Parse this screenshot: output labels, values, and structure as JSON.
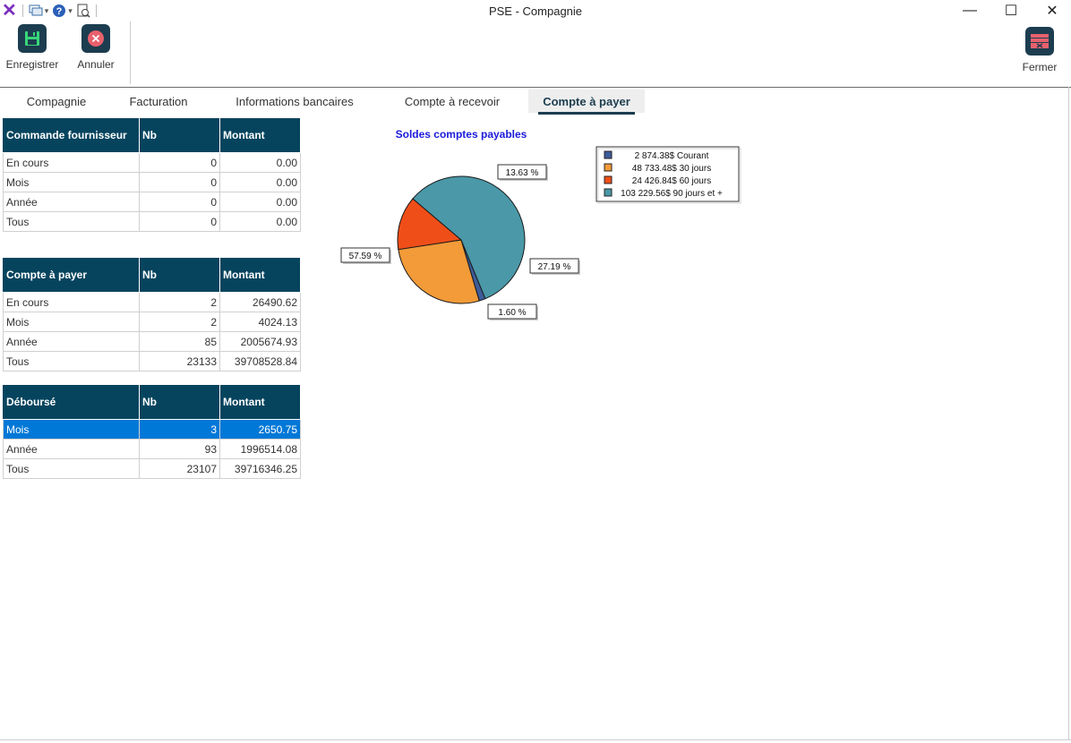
{
  "window": {
    "title": "PSE - Compagnie",
    "minimize": "—",
    "maximize": "☐",
    "close": "✕"
  },
  "toolbar": {
    "save_label": "Enregistrer",
    "cancel_label": "Annuler",
    "close_label": "Fermer"
  },
  "tabs": [
    {
      "label": "Compagnie"
    },
    {
      "label": "Facturation"
    },
    {
      "label": "Informations bancaires"
    },
    {
      "label": "Compte à recevoir"
    },
    {
      "label": "Compte à payer",
      "active": true
    }
  ],
  "tables": {
    "commande": {
      "headers": [
        "Commande fournisseur",
        "Nb",
        "Montant"
      ],
      "rows": [
        [
          "En cours",
          "0",
          "0.00"
        ],
        [
          "Mois",
          "0",
          "0.00"
        ],
        [
          "Année",
          "0",
          "0.00"
        ],
        [
          "Tous",
          "0",
          "0.00"
        ]
      ]
    },
    "compte": {
      "headers": [
        "Compte à payer",
        "Nb",
        "Montant"
      ],
      "rows": [
        [
          "En cours",
          "2",
          "26490.62"
        ],
        [
          "Mois",
          "2",
          "4024.13"
        ],
        [
          "Année",
          "85",
          "2005674.93"
        ],
        [
          "Tous",
          "23133",
          "39708528.84"
        ]
      ]
    },
    "debourse": {
      "headers": [
        "Déboursé",
        "Nb",
        "Montant"
      ],
      "rows": [
        [
          "Mois",
          "3",
          "2650.75"
        ],
        [
          "Année",
          "93",
          "1996514.08"
        ],
        [
          "Tous",
          "23107",
          "39716346.25"
        ]
      ],
      "selected_row": 0
    }
  },
  "colors": {
    "header_bg": "#06445e",
    "selection": "#0078d7",
    "accent": "#1c3d4f"
  },
  "chart_data": {
    "type": "pie",
    "title": "Soldes comptes payables",
    "legend_position": "top-right",
    "slices": [
      {
        "legend": "2 874.38$ Courant",
        "value": 2874.38,
        "percent_label": "1.60 %",
        "color": "#3e5c9a"
      },
      {
        "legend": "48 733.48$ 30 jours",
        "value": 48733.48,
        "percent_label": "27.19 %",
        "color": "#f29b38"
      },
      {
        "legend": "24 426.84$ 60 jours",
        "value": 24426.84,
        "percent_label": "13.63 %",
        "color": "#f04e19"
      },
      {
        "legend": "103 229.56$ 90 jours et +",
        "value": 103229.56,
        "percent_label": "57.59 %",
        "color": "#4a98a8"
      }
    ]
  }
}
